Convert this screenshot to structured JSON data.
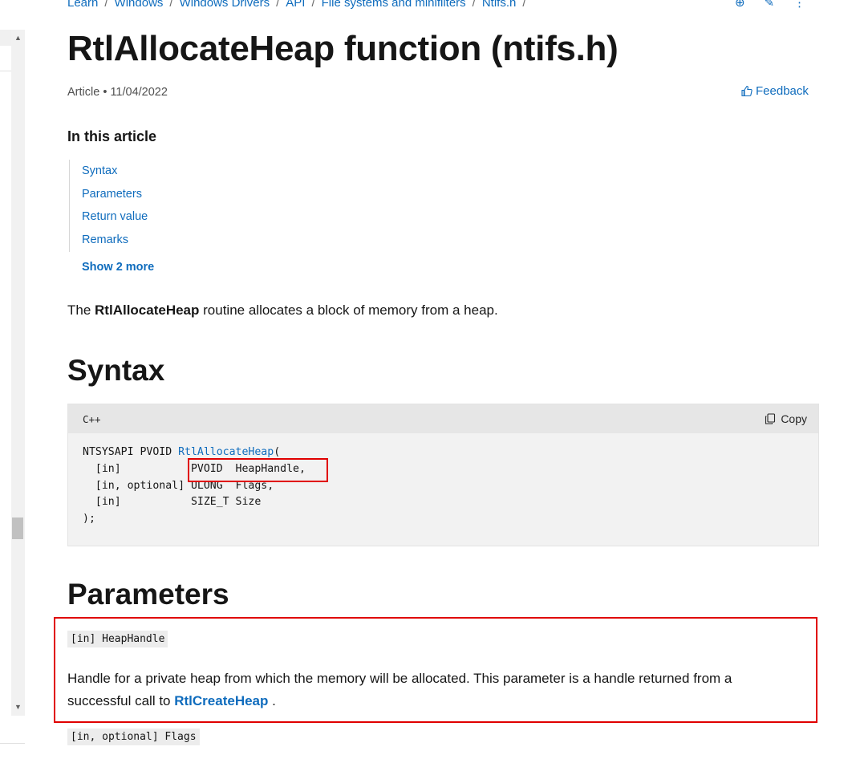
{
  "breadcrumb": [
    "Learn",
    "Windows",
    "Windows Drivers",
    "API",
    "File systems and minifilters",
    "Ntifs.h"
  ],
  "page_title": "RtlAllocateHeap function (ntifs.h)",
  "meta": {
    "type": "Article",
    "date": "11/04/2022"
  },
  "feedback_label": "Feedback",
  "toc": {
    "title": "In this article",
    "items": [
      "Syntax",
      "Parameters",
      "Return value",
      "Remarks"
    ],
    "show_more": "Show 2 more"
  },
  "intro": {
    "before": "The ",
    "bold": "RtlAllocateHeap",
    "after": " routine allocates a block of memory from a heap."
  },
  "syntax": {
    "heading": "Syntax",
    "language": "C++",
    "copy_label": "Copy",
    "line1_prefix": "NTSYSAPI PVOID ",
    "line1_link": "RtlAllocateHeap",
    "line1_suffix": "(",
    "line2": "  [in]           PVOID  HeapHandle,",
    "line3": "  [in, optional] ULONG  Flags,",
    "line4": "  [in]           SIZE_T Size",
    "line5": ");"
  },
  "parameters": {
    "heading": "Parameters",
    "param1_tag": "[in] HeapHandle",
    "param1_desc_before": "Handle for a private heap from which the memory will be allocated. This parameter is a handle returned from a successful call to ",
    "param1_link": "RtlCreateHeap",
    "param1_desc_after": " .",
    "param2_tag": "[in, optional] Flags"
  },
  "colors": {
    "link": "#0f6cbd",
    "highlight": "#e00000"
  }
}
